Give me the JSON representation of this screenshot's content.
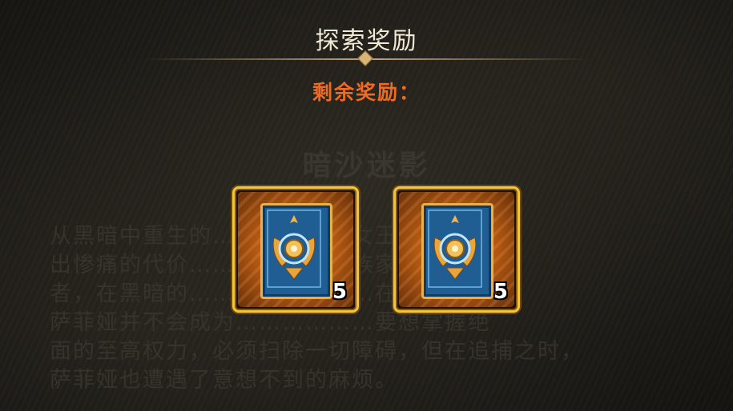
{
  "header": {
    "title": "探索奖励",
    "subtitle": "剩余奖励："
  },
  "background_lore": {
    "title": "暗沙迷影",
    "lines": [
      "从黑暗中重生的………………女王虽引拉付",
      "出惨痛的代价………………氏族家族的败",
      "者，在黑暗的……………………在沙漠腹地，",
      "萨菲娅并不会成为………………要想掌握绝",
      "面的至高权力，必须扫除一切障碍，但在追捕之时，",
      "萨菲娅也遭遇了意想不到的麻烦。"
    ]
  },
  "rewards": [
    {
      "item_icon": "card-back-icon",
      "count": "5"
    },
    {
      "item_icon": "card-back-icon",
      "count": "5"
    }
  ],
  "colors": {
    "title": "#f2ead6",
    "subtitle": "#f06a22",
    "frame_gold": "#f2c53a",
    "card_blue": "#1f5d93"
  }
}
